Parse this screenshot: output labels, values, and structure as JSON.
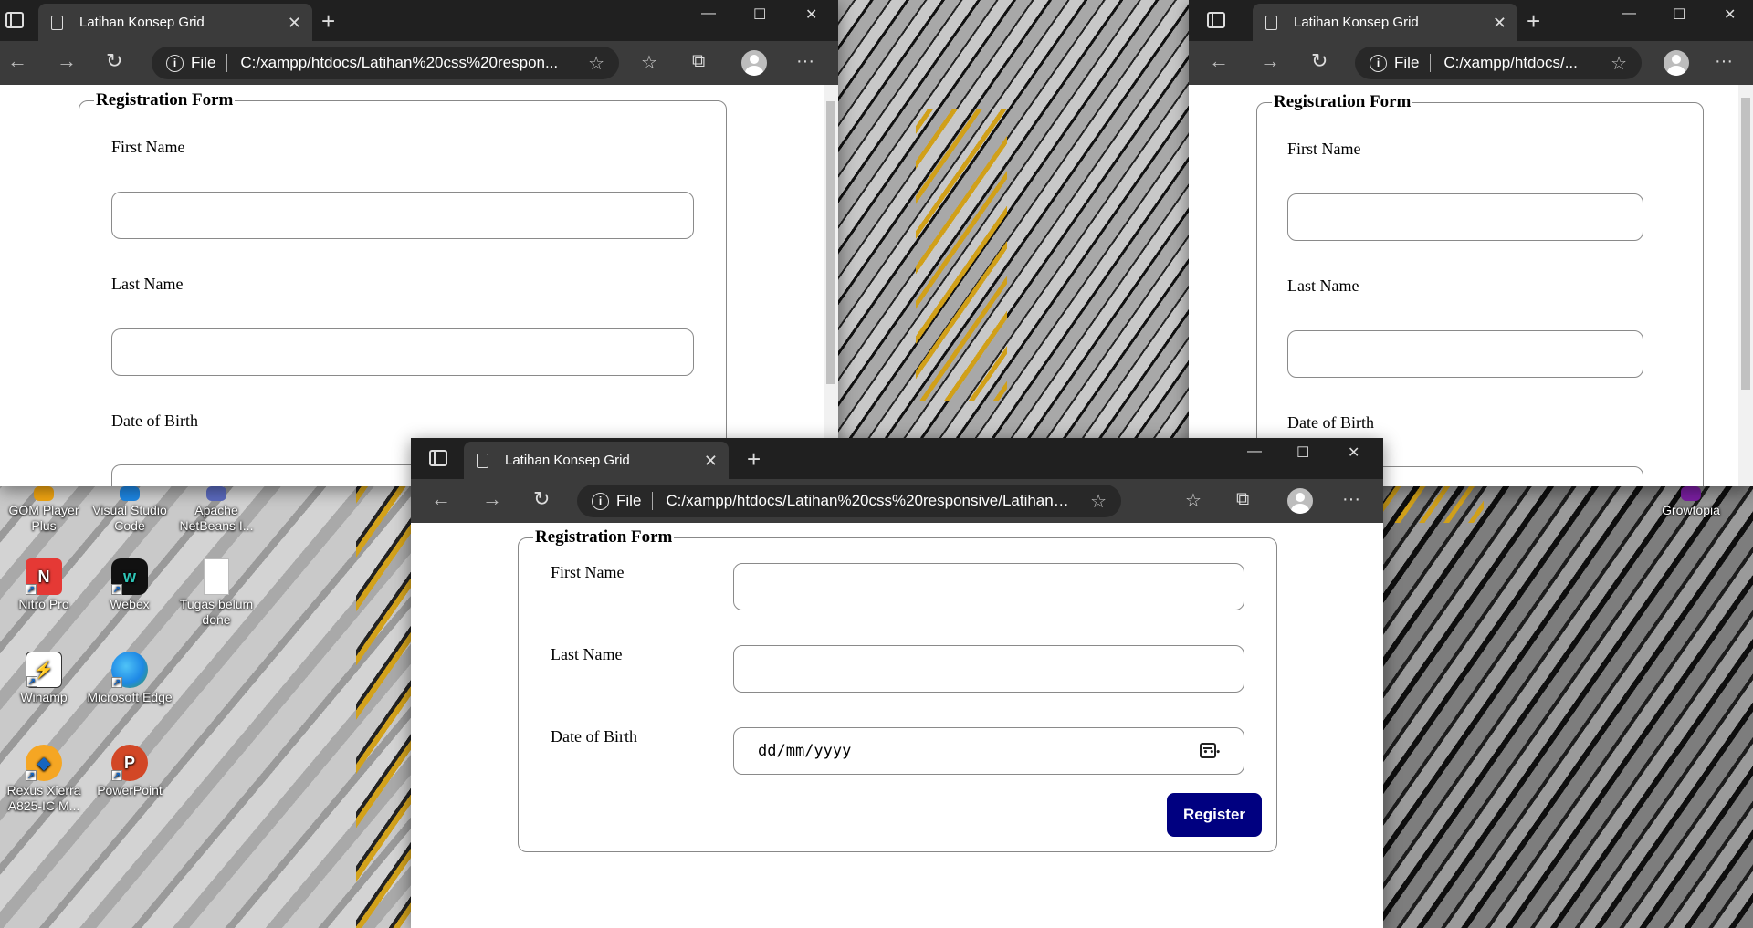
{
  "browser": {
    "tab_title": "Latihan Konsep Grid",
    "file_label": "File",
    "url_full": "C:/xampp/htdocs/Latihan%20css%20responsive/Latihan%206...",
    "url_left": "C:/xampp/htdocs/Latihan%20css%20respon...",
    "url_right": "C:/xampp/htdocs/..."
  },
  "form": {
    "legend": "Registration Form",
    "first_name_label": "First Name",
    "last_name_label": "Last Name",
    "dob_label": "Date of Birth",
    "dob_placeholder": "dd/mm/yyyy",
    "register_label": "Register"
  },
  "desktop": {
    "icons": [
      {
        "label": "GOM Player Plus",
        "icon": "gom-player-icon"
      },
      {
        "label": "Visual Studio Code",
        "icon": "vscode-icon"
      },
      {
        "label": "Apache NetBeans I...",
        "icon": "netbeans-icon"
      },
      {
        "label": "Nitro Pro",
        "icon": "nitro-pro-icon"
      },
      {
        "label": "Webex",
        "icon": "webex-icon"
      },
      {
        "label": "Tugas belum done",
        "icon": "text-file-icon"
      },
      {
        "label": "Winamp",
        "icon": "winamp-icon"
      },
      {
        "label": "Microsoft Edge",
        "icon": "edge-icon"
      },
      {
        "label": "Rexus Xierra A825-IC M...",
        "icon": "rexus-icon"
      },
      {
        "label": "PowerPoint",
        "icon": "powerpoint-icon"
      },
      {
        "label": "Growtopia",
        "icon": "growtopia-icon"
      }
    ]
  },
  "colors": {
    "register_button": "#000080",
    "titlebar": "#202020",
    "toolbar": "#3b3b3b"
  }
}
